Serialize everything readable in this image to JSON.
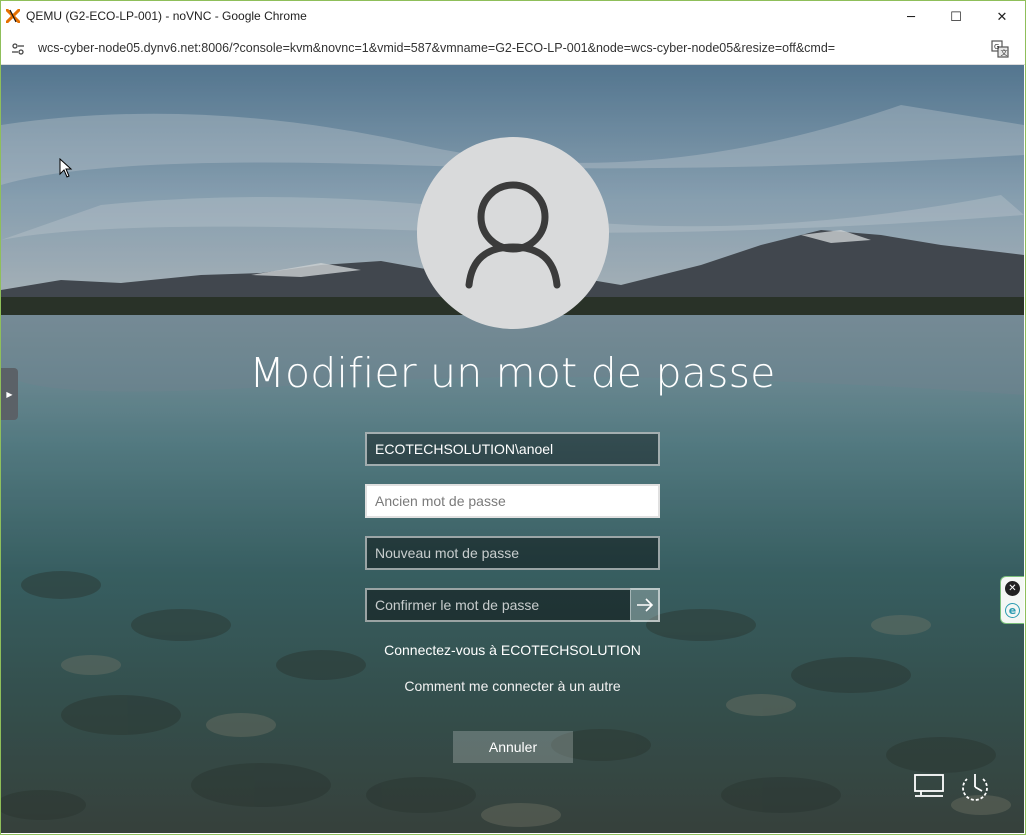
{
  "window": {
    "title": "QEMU (G2-ECO-LP-001) - noVNC - Google Chrome",
    "minimize_glyph": "─",
    "maximize_glyph": "☐",
    "close_glyph": "✕"
  },
  "address_bar": {
    "url": "wcs-cyber-node05.dynv6.net:8006/?console=kvm&novnc=1&vmid=587&vmname=G2-ECO-LP-001&node=wcs-cyber-node05&resize=off&cmd="
  },
  "login": {
    "title": "Modifier un mot de passe",
    "username_value": "ECOTECHSOLUTION\\anoel",
    "old_password_placeholder": "Ancien mot de passe",
    "new_password_placeholder": "Nouveau mot de passe",
    "confirm_password_placeholder": "Confirmer le mot de passe",
    "connect_domain_link": "Connectez-vous à ECOTECHSOLUTION",
    "other_domain_link": "Comment me connecter à un autre",
    "cancel_label": "Annuler"
  },
  "icons": {
    "app": "qemu-logo-icon",
    "site_info": "site-settings-icon",
    "translate": "translate-icon",
    "avatar": "user-avatar-icon",
    "submit": "arrow-right-icon",
    "network": "network-icon",
    "power": "accessibility-power-icon",
    "novnc_handle": "chevron-right-icon",
    "extension_close": "close-icon",
    "extension": "extension-e-icon",
    "cursor": "mouse-cursor-icon"
  },
  "colors": {
    "window_border": "#8fbf5a",
    "avatar_bg": "#d9dadb",
    "text": "#ffffff"
  }
}
